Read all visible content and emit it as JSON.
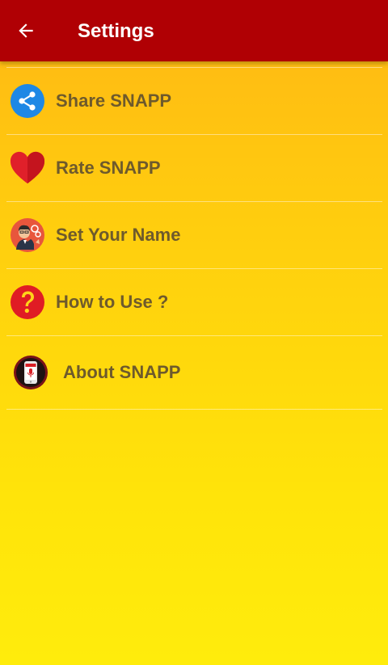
{
  "appbar": {
    "title": "Settings",
    "back_icon": "arrow-left-icon",
    "background_color": "#B00004"
  },
  "menu": {
    "items": [
      {
        "label": "Share SNAPP",
        "icon": "share-icon",
        "icon_color": "#1E88E5"
      },
      {
        "label": "Rate SNAPP",
        "icon": "heart-icon",
        "icon_color": "#E0202A"
      },
      {
        "label": "Set Your Name",
        "icon": "user-avatar-icon",
        "icon_color": "#E8563C"
      },
      {
        "label": "How to Use ?",
        "icon": "question-icon",
        "icon_color": "#E01C24"
      },
      {
        "label": "About SNAPP",
        "icon": "app-phone-icon",
        "icon_color": "#7A1418"
      }
    ]
  },
  "colors": {
    "label_text": "#6E5A2C",
    "background_top": "#FFB714",
    "background_bottom": "#FFEC0C"
  }
}
